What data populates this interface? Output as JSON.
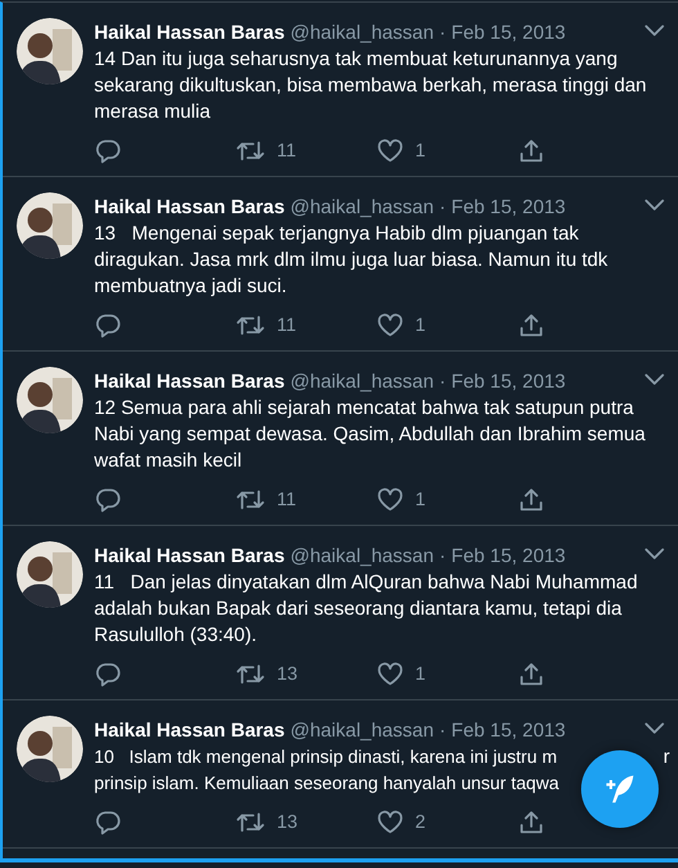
{
  "tweets": [
    {
      "name": "Haikal Hassan Baras",
      "handle": "@haikal_hassan",
      "dot": "·",
      "date": "Feb 15, 2013",
      "text": "14 Dan itu juga seharusnya tak membuat keturunannya yang sekarang dikultuskan, bisa membawa berkah, merasa tinggi dan merasa mulia",
      "retweets": "11",
      "likes": "1"
    },
    {
      "name": "Haikal Hassan Baras",
      "handle": "@haikal_hassan",
      "dot": "·",
      "date": "Feb 15, 2013",
      "text": "13   Mengenai sepak terjangnya Habib dlm pjuangan tak diragukan. Jasa mrk dlm ilmu juga luar biasa. Namun itu tdk membuatnya jadi suci.",
      "retweets": "11",
      "likes": "1"
    },
    {
      "name": "Haikal Hassan Baras",
      "handle": "@haikal_hassan",
      "dot": "·",
      "date": "Feb 15, 2013",
      "text": "12 Semua para ahli sejarah mencatat bahwa tak satupun putra Nabi yang sempat dewasa. Qasim, Abdullah dan Ibrahim semua wafat masih kecil",
      "retweets": "11",
      "likes": "1"
    },
    {
      "name": "Haikal Hassan Baras",
      "handle": "@haikal_hassan",
      "dot": "·",
      "date": "Feb 15, 2013",
      "text": "11   Dan jelas dinyatakan dlm AlQuran bahwa Nabi Muhammad adalah bukan Bapak dari seseorang diantara kamu, tetapi dia Rasululloh (33:40).",
      "retweets": "13",
      "likes": "1"
    },
    {
      "name": "Haikal Hassan Baras",
      "handle": "@haikal_hassan",
      "dot": "·",
      "date": "Feb 15, 2013",
      "text": "10   Islam tdk mengenal prinsip dinasti, karena ini justru m\nprinsip islam. Kemuliaan seseorang hanyalah unsur taqwa",
      "covered_tail": "r",
      "retweets": "13",
      "likes": "2"
    }
  ]
}
